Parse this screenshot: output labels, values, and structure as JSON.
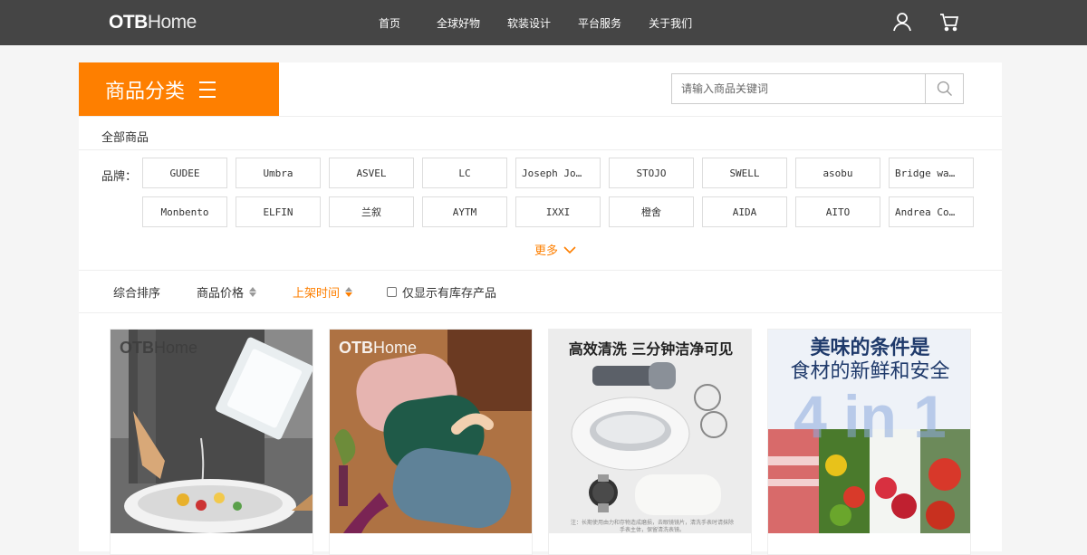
{
  "header": {
    "logo_bold": "OTB",
    "logo_light": "Home",
    "nav": [
      "首页",
      "全球好物",
      "软装设计",
      "平台服务",
      "关于我们"
    ],
    "icons": [
      "user-icon",
      "cart-icon"
    ]
  },
  "category": {
    "title": "商品分类",
    "all_goods": "全部商品",
    "brand_label": "品牌：",
    "brands": [
      "GUDEE",
      "Umbra",
      "ASVEL",
      "LC",
      "Joseph Jo…",
      "STOJO",
      "SWELL",
      "asobu",
      "Bridge wa…",
      "Monbento",
      "ELFIN",
      "兰叙",
      "AYTM",
      "IXXI",
      "橙舍",
      "AIDA",
      "AITO",
      "Andrea Co…"
    ],
    "more": "更多"
  },
  "search": {
    "placeholder": "请输入商品关键词"
  },
  "sort": {
    "items": [
      "综合排序",
      "商品价格",
      "上架时间"
    ],
    "active": "上架时间",
    "stock_only": "仅显示有库存产品"
  },
  "products": {
    "watermark_bold": "OTB",
    "watermark_light": "Home",
    "p3_headline": "高效清洗 三分钟洁净可见",
    "p3_note": "注：长期使用由力和存物造成磨损，去眼镜镜片，清洗手表时请抹除手表主体，保留清洗表镜。",
    "p4_line1": "美味的条件是",
    "p4_line2": "食材的新鲜和安全",
    "p4_big": "4 in 1"
  },
  "colors": {
    "accent": "#fe7f00",
    "topbar": "#454545"
  }
}
